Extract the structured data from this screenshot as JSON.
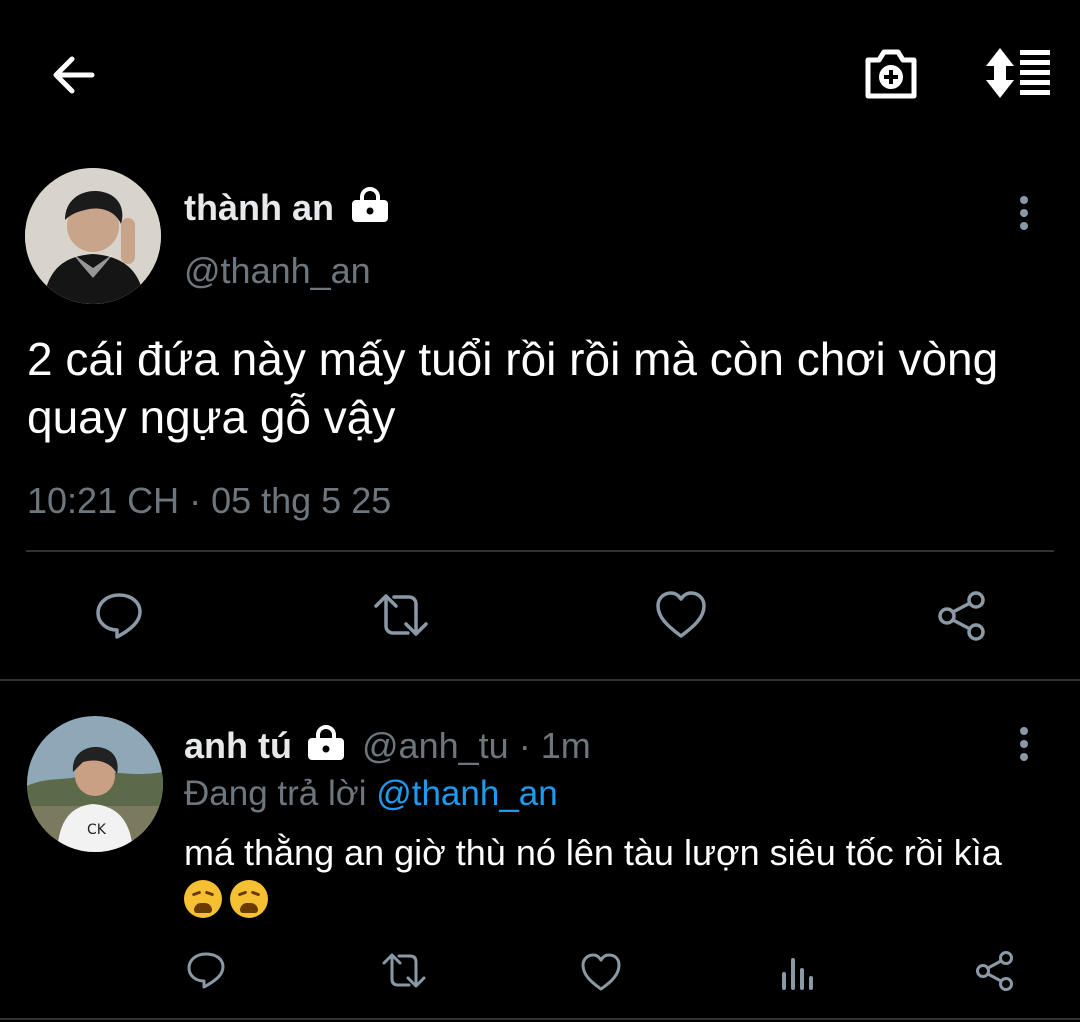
{
  "header": {
    "back_icon": "arrow-left-icon",
    "camera_icon": "camera-add-icon",
    "sort_icon": "sort-list-icon"
  },
  "main_tweet": {
    "display_name": "thành an",
    "handle": "@thanh_an",
    "lock_icon": "lock-icon",
    "more_icon": "more-vertical-icon",
    "text_line1": "2 cái đứa này mấy tuổi rồi rồi mà còn chơi vòng",
    "text_line2": "quay ngựa gỗ vậy",
    "timestamp": "10:21 CH · 05 thg 5 25",
    "actions": [
      "reply-icon",
      "retweet-icon",
      "like-icon",
      "share-icon"
    ]
  },
  "reply_tweet": {
    "display_name": "anh tú",
    "handle": "@anh_tu",
    "time_sep": "·",
    "time": "1m",
    "replying_prefix": "Đang trả lời",
    "replying_to": "@thanh_an",
    "text": "má thằng an giờ thù nó lên tàu lượn siêu tốc rồi kìa",
    "emoji_count": 2,
    "actions": [
      "reply-icon",
      "retweet-icon",
      "like-icon",
      "analytics-icon",
      "share-icon"
    ]
  },
  "colors": {
    "background": "#000000",
    "text": "#e7e9ea",
    "muted": "#6e767d",
    "link": "#1d9bf0",
    "divider": "#2f3336"
  }
}
